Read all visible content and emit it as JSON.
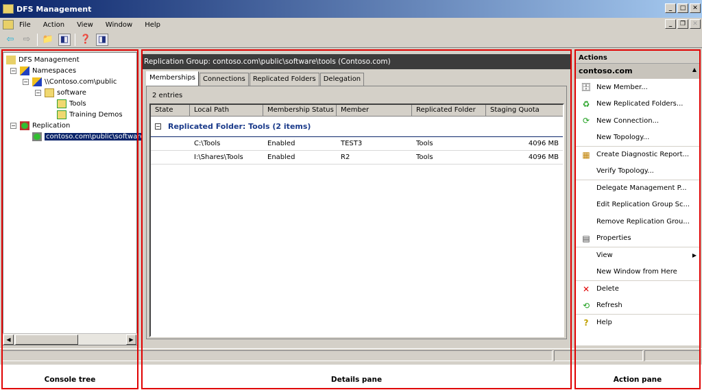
{
  "window": {
    "title": "DFS Management",
    "min": "_",
    "max": "□",
    "close": "✕",
    "mdi_min": "_",
    "mdi_restore": "❐",
    "mdi_close": "✕"
  },
  "menu": [
    "File",
    "Action",
    "View",
    "Window",
    "Help"
  ],
  "tree": {
    "root": "DFS Management",
    "namespaces": "Namespaces",
    "namespace": "\\\\Contoso.com\\public",
    "folder": "software",
    "tools": "Tools",
    "training": "Training Demos",
    "replication": "Replication",
    "group": "contoso.com\\public\\software"
  },
  "details": {
    "header": "Replication Group: contoso.com\\public\\software\\tools (Contoso.com)",
    "tabs": [
      "Memberships",
      "Connections",
      "Replicated Folders",
      "Delegation"
    ],
    "entries": "2 entries",
    "columns": [
      "State",
      "Local Path",
      "Membership Status",
      "Member",
      "Replicated Folder",
      "Staging Quota"
    ],
    "group_label": "Replicated Folder: Tools (2 items)",
    "group_toggle": "−",
    "rows": [
      {
        "state": "",
        "path": "C:\\Tools",
        "status": "Enabled",
        "member": "TEST3",
        "folder": "Tools",
        "quota": "4096 MB"
      },
      {
        "state": "",
        "path": "I:\\Shares\\Tools",
        "status": "Enabled",
        "member": "R2",
        "folder": "Tools",
        "quota": "4096 MB"
      }
    ]
  },
  "actions": {
    "header": "Actions",
    "section": "contoso.com",
    "items": [
      {
        "label": "New Member...",
        "icon": "🗄"
      },
      {
        "label": "New Replicated Folders...",
        "icon": "♻"
      },
      {
        "label": "New Connection...",
        "icon": "⟳"
      },
      {
        "label": "New Topology...",
        "icon": ""
      },
      {
        "label": "Create Diagnostic Report...",
        "icon": "▦"
      },
      {
        "label": "Verify Topology...",
        "icon": ""
      },
      {
        "label": "Delegate Management P...",
        "icon": ""
      },
      {
        "label": "Edit Replication Group Sc...",
        "icon": ""
      },
      {
        "label": "Remove Replication Grou...",
        "icon": ""
      },
      {
        "label": "Properties",
        "icon": "▤"
      },
      {
        "label": "View",
        "icon": ""
      },
      {
        "label": "New Window from Here",
        "icon": ""
      },
      {
        "label": "Delete",
        "icon": "✕"
      },
      {
        "label": "Refresh",
        "icon": "⟲"
      },
      {
        "label": "Help",
        "icon": "?"
      }
    ]
  },
  "captions": {
    "console": "Console tree",
    "details": "Details pane",
    "action": "Action pane"
  },
  "colors": {
    "annotation": "#e00000",
    "selection": "#0a246a"
  }
}
